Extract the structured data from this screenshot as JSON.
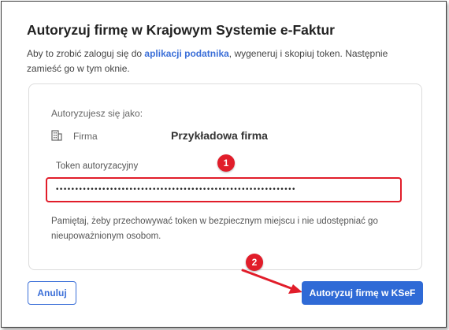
{
  "dialog": {
    "title": "Autoryzuj firmę w Krajowym Systemie e-Faktur",
    "description_before": "Aby to zrobić zaloguj się do ",
    "description_link": "aplikacji podatnika",
    "description_after": ", wygeneruj i skopiuj token. Następnie zamieść go w tym oknie."
  },
  "panel": {
    "authorizing_as_label": "Autoryzujesz się jako:",
    "company_key": "Firma",
    "company_value": "Przykładowa firma",
    "token_label": "Token autoryzacyjny",
    "token_value": "••••••••••••••••••••••••••••••••••••••••••••••••••••••••••••••",
    "note": "Pamiętaj, żeby przechowywać token w bezpiecznym miejscu i nie udostępniać go nieupoważnionym osobom."
  },
  "annotations": {
    "badge1": "1",
    "badge2": "2",
    "color": "#e11d2a"
  },
  "buttons": {
    "cancel_label": "Anuluj",
    "authorize_label": "Autoryzuj firmę w KSeF"
  },
  "icons": {
    "company": "building-icon"
  },
  "colors": {
    "accent": "#2f6ad6",
    "error_border": "#e11d2a"
  }
}
